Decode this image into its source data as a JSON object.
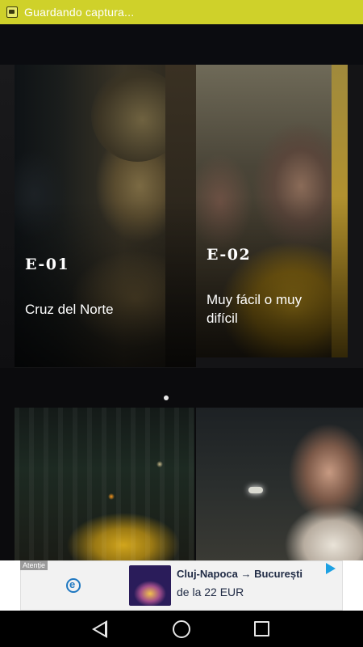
{
  "status_bar": {
    "notification_text": "Guardando captura...",
    "notification_icon": "screenshot-icon"
  },
  "episodes": [
    {
      "code": "E-01",
      "title": "Cruz del Norte"
    },
    {
      "code": "E-02",
      "title": "Muy fácil o muy difícil"
    }
  ],
  "carousel": {
    "page_count_visible": 1,
    "active_index": 0
  },
  "ad": {
    "label": "Atenție",
    "route": "Cluj-Napoca → București",
    "price": "de la 22 EUR",
    "logo_icon": "e-logo-icon",
    "play_icon": "adchoices-play-icon"
  },
  "nav": {
    "back_icon": "back-icon",
    "home_icon": "home-icon",
    "recents_icon": "recents-icon"
  },
  "colors": {
    "status_bar": "#cfd12a",
    "background": "#0b0b0d",
    "ad_accent": "#1da1e3"
  }
}
